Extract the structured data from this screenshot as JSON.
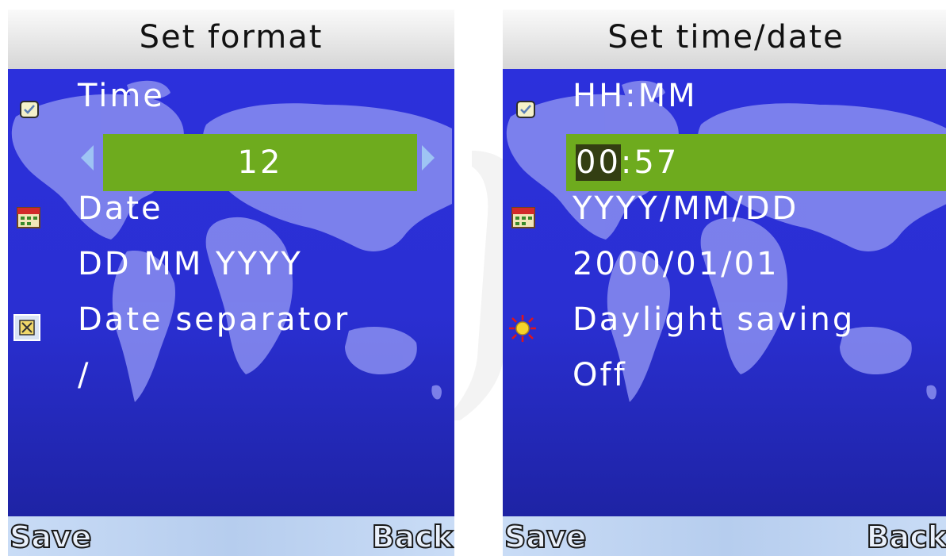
{
  "left_screen": {
    "title": "Set format",
    "time_label": "Time",
    "time_value": "12",
    "date_label": "Date",
    "date_value": "DD MM YYYY",
    "separator_label": "Date separator",
    "separator_value": "/",
    "softkey_left": "Save",
    "softkey_right": "Back"
  },
  "right_screen": {
    "title": "Set time/date",
    "time_label": "HH:MM",
    "time_value_hour": "00",
    "time_value_rest": ":57",
    "date_label": "YYYY/MM/DD",
    "date_value": "2000/01/01",
    "dst_label": "Daylight saving",
    "dst_value": "Off",
    "softkey_left": "Save",
    "softkey_right": "Back"
  },
  "icons": {
    "time": "clock-check-icon",
    "date": "calendar-icon",
    "separator": "separator-icon",
    "daylight": "sun-icon"
  },
  "colors": {
    "background_blue": "#2a2fd6",
    "map_land": "#8a8ef0",
    "selector_green": "#6eab1e",
    "title_bar": "#e8e8e8",
    "softkey_bar": "#c2d6f4"
  }
}
